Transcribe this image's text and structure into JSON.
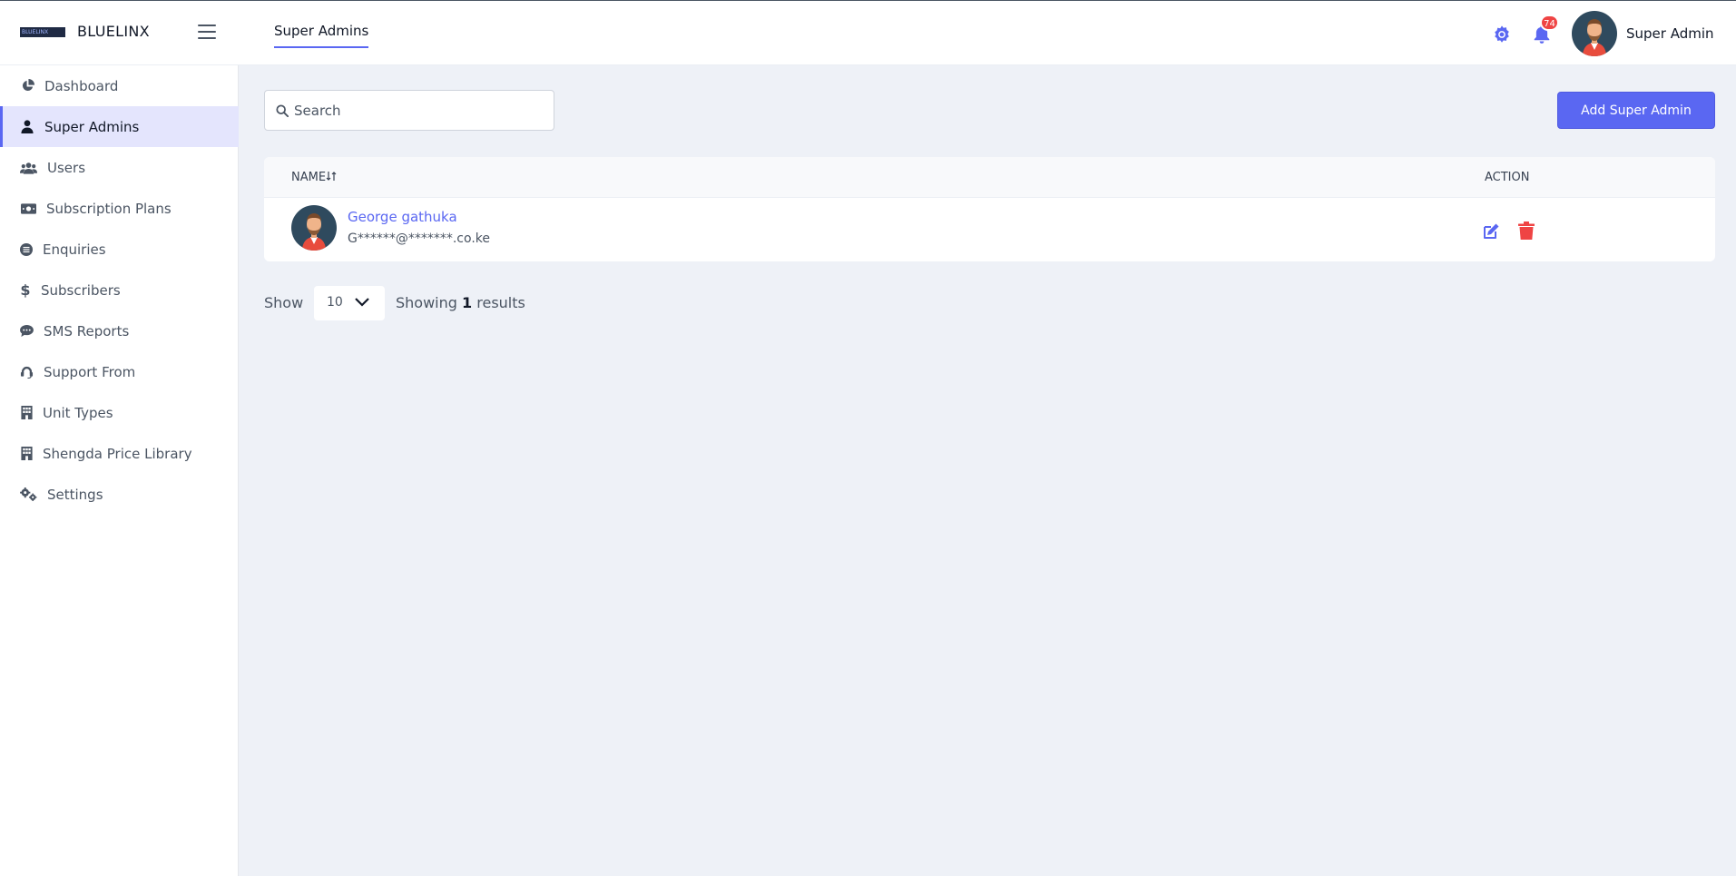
{
  "app": {
    "logo_text": "BLUELINX",
    "brand": "BLUELINX"
  },
  "header": {
    "page_tab": "Super Admins",
    "notification_count": "74",
    "user_name": "Super Admin",
    "icons": [
      "menu-icon",
      "gear-icon",
      "bell-icon"
    ]
  },
  "sidebar": {
    "items": [
      {
        "label": "Dashboard",
        "icon": "pie-chart-icon",
        "active": false
      },
      {
        "label": "Super Admins",
        "icon": "user-icon",
        "active": true
      },
      {
        "label": "Users",
        "icon": "users-icon",
        "active": false
      },
      {
        "label": "Subscription Plans",
        "icon": "money-bill-icon",
        "active": false
      },
      {
        "label": "Enquiries",
        "icon": "list-circle-icon",
        "active": false
      },
      {
        "label": "Subscribers",
        "icon": "dollar-icon",
        "active": false
      },
      {
        "label": "SMS Reports",
        "icon": "chat-bubble-icon",
        "active": false
      },
      {
        "label": "Support From",
        "icon": "headset-icon",
        "active": false
      },
      {
        "label": "Unit Types",
        "icon": "building-icon",
        "active": false
      },
      {
        "label": "Shengda Price Library",
        "icon": "building-icon",
        "active": false
      },
      {
        "label": "Settings",
        "icon": "gears-icon",
        "active": false
      }
    ]
  },
  "toolbar": {
    "search_placeholder": "Search",
    "add_button": "Add Super Admin"
  },
  "table": {
    "columns": {
      "name": "NAME",
      "action": "ACTION"
    },
    "rows": [
      {
        "name": "George gathuka",
        "email": "G******@*******.co.ke"
      }
    ]
  },
  "pagination": {
    "show_label": "Show",
    "page_size": "10",
    "results_prefix": "Showing",
    "results_count": "1",
    "results_suffix": "results"
  },
  "colors": {
    "accent": "#5a67f2",
    "danger": "#ef4444",
    "active_bg": "#e4e5fd",
    "page_bg": "#eef1f7"
  }
}
